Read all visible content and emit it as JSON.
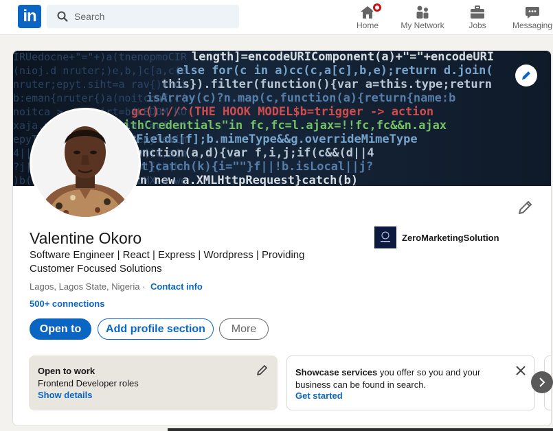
{
  "nav": {
    "logo_text": "in",
    "search_placeholder": "Search",
    "items": [
      {
        "label": "Home",
        "icon": "home-icon"
      },
      {
        "label": "My Network",
        "icon": "people-icon"
      },
      {
        "label": "Jobs",
        "icon": "briefcase-icon"
      },
      {
        "label": "Messaging",
        "icon": "chat-icon"
      }
    ]
  },
  "profile": {
    "name": "Valentine Okoro",
    "headline": "Software Engineer | React | Express | Wordpress | Providing Customer Focused Solutions",
    "location": "Lagos, Lagos State, Nigeria",
    "separator": "·",
    "contact_info": "Contact info",
    "connections": "500+ connections",
    "company": "ZeroMarketingSolution"
  },
  "actions": {
    "open_to": "Open to",
    "add_section": "Add profile section",
    "more": "More"
  },
  "open_to_work": {
    "title": "Open to work",
    "roles": "Frontend Developer roles",
    "link": "Show details"
  },
  "showcase": {
    "bold": "Showcase services",
    "text": " you offer so you and your business can be found in search.",
    "link": "Get started"
  },
  "banner_code_lines": [
    "length]=encodeURIComponent(a)+\"=\"+encodeURI",
    "else for(c in a)cc(c,a[c],b,e);return d.join(",
    "this}).filter(function(){var a=this.type;return",
    "isArray(c)?n.map(c,function(a){return{name:b",
    "gc()://^(THE HOOK MODEL$b=trigger -> action",
    "withCredentials\"in fc,fc=l.ajax=!!fc,fc&&n.ajax",
    "b.xhrFields[f];b.mimeType&&g.overrideMimeType",
    "ull,c=function(a,d){var f,i,j;if(c&&(d||4",
    ".statusText}catch(k){i=\"\"}f||!b.isLocal||j?",
    "n){try{return new a.XMLHttpRequest}catch(b)"
  ],
  "colors": {
    "brand": "#0a66c2",
    "notification": "#cc1016",
    "open_to_work_bg": "#e9e5df"
  }
}
